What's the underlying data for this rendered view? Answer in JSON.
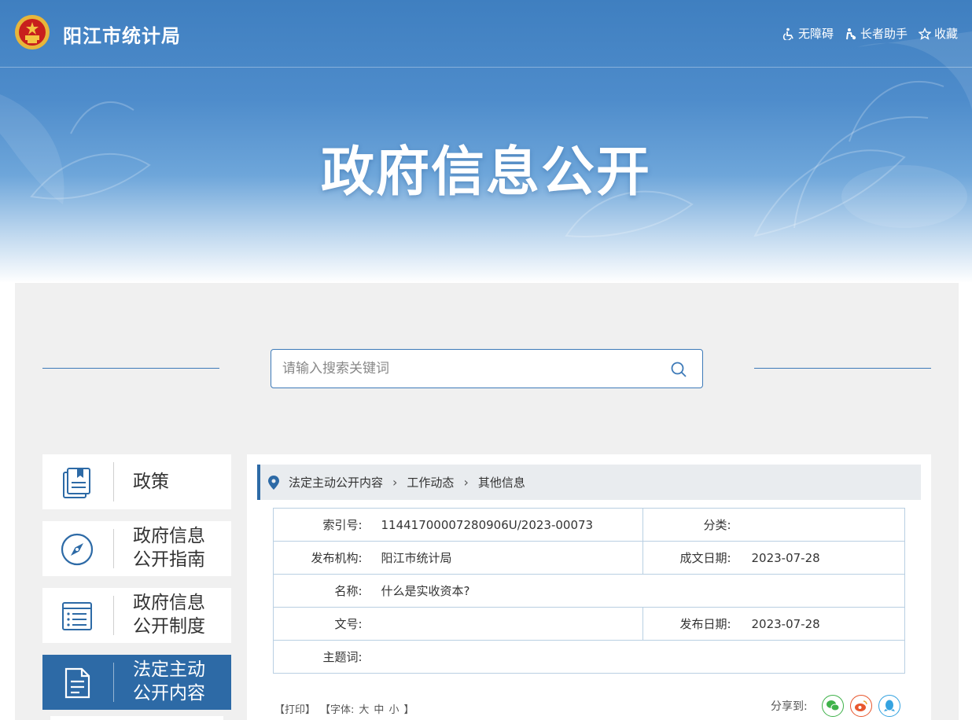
{
  "header": {
    "site_name": "阳江市统计局",
    "links": [
      {
        "label": "无障碍",
        "icon": "accessibility-icon"
      },
      {
        "label": "长者助手",
        "icon": "elder-assist-icon"
      },
      {
        "label": "收藏",
        "icon": "star-icon"
      }
    ]
  },
  "banner": {
    "title": "政府信息公开"
  },
  "search": {
    "placeholder": "请输入搜索关键词"
  },
  "sidebar": {
    "items": [
      {
        "label_line1": "政策",
        "label_line2": "",
        "icon": "policy-book-icon",
        "active": false
      },
      {
        "label_line1": "政府信息",
        "label_line2": "公开指南",
        "icon": "compass-icon",
        "active": false
      },
      {
        "label_line1": "政府信息",
        "label_line2": "公开制度",
        "icon": "list-document-icon",
        "active": false
      },
      {
        "label_line1": "法定主动",
        "label_line2": "公开内容",
        "icon": "document-icon",
        "active": true
      }
    ]
  },
  "breadcrumb": [
    "法定主动公开内容",
    "工作动态",
    "其他信息"
  ],
  "meta": {
    "index_label": "索引号:",
    "index_value": "11441700007280906U/2023-00073",
    "category_label": "分类:",
    "category_value": "",
    "publisher_label": "发布机构:",
    "publisher_value": "阳江市统计局",
    "written_date_label": "成文日期:",
    "written_date_value": "2023-07-28",
    "name_label": "名称:",
    "name_value": "什么是实收资本?",
    "doc_no_label": "文号:",
    "doc_no_value": "",
    "publish_date_label": "发布日期:",
    "publish_date_value": "2023-07-28",
    "keywords_label": "主题词:",
    "keywords_value": ""
  },
  "tools": {
    "print": "【打印】",
    "font_open": "【字体:",
    "font_large": "大",
    "font_medium": "中",
    "font_small": "小",
    "font_close": "】"
  },
  "share": {
    "label": "分享到:",
    "targets": [
      "wechat-icon",
      "weibo-icon",
      "qq-icon"
    ]
  },
  "colors": {
    "primary": "#2d6aa6",
    "banner": "#4e8ccb",
    "panel": "#f0f0f0"
  }
}
